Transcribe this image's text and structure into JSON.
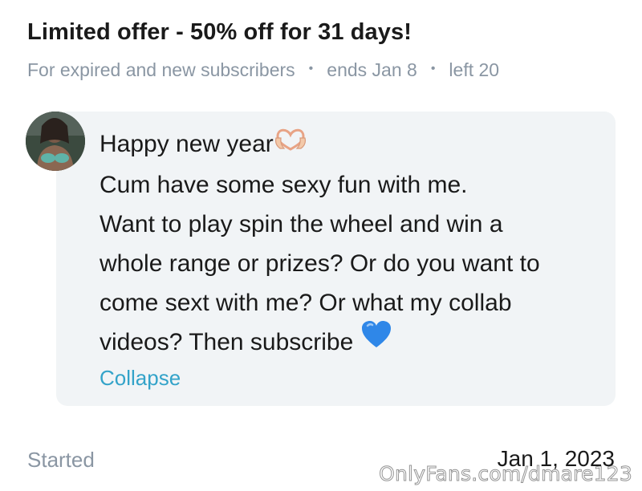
{
  "offer": {
    "title": "Limited offer - 50% off for 31 days!",
    "audience": "For expired and new subscribers",
    "separator": "•",
    "ends": "ends Jan 8",
    "left": "left 20"
  },
  "message": {
    "avatar_icon": "profile-avatar",
    "line1": "Happy new year",
    "line1_emoji": "heart-hands-emoji",
    "line2": "Cum have some sexy fun with me.",
    "line3": "Want to play spin the wheel and win a",
    "line4": "whole range or prizes? Or do you want to",
    "line5": "come sext with me? Or what my collab",
    "line6": "videos? Then subscribe",
    "line6_emoji": "blue-heart-emoji",
    "collapse_label": "Collapse"
  },
  "footer": {
    "started_label": "Started",
    "started_date": "Jan 1, 2023",
    "watermark": "OnlyFans.com/dmare123"
  },
  "colors": {
    "accent": "#33a3c9",
    "muted": "#8a96a3",
    "card_bg": "#f1f4f6",
    "blue_heart": "#2f87e8"
  }
}
